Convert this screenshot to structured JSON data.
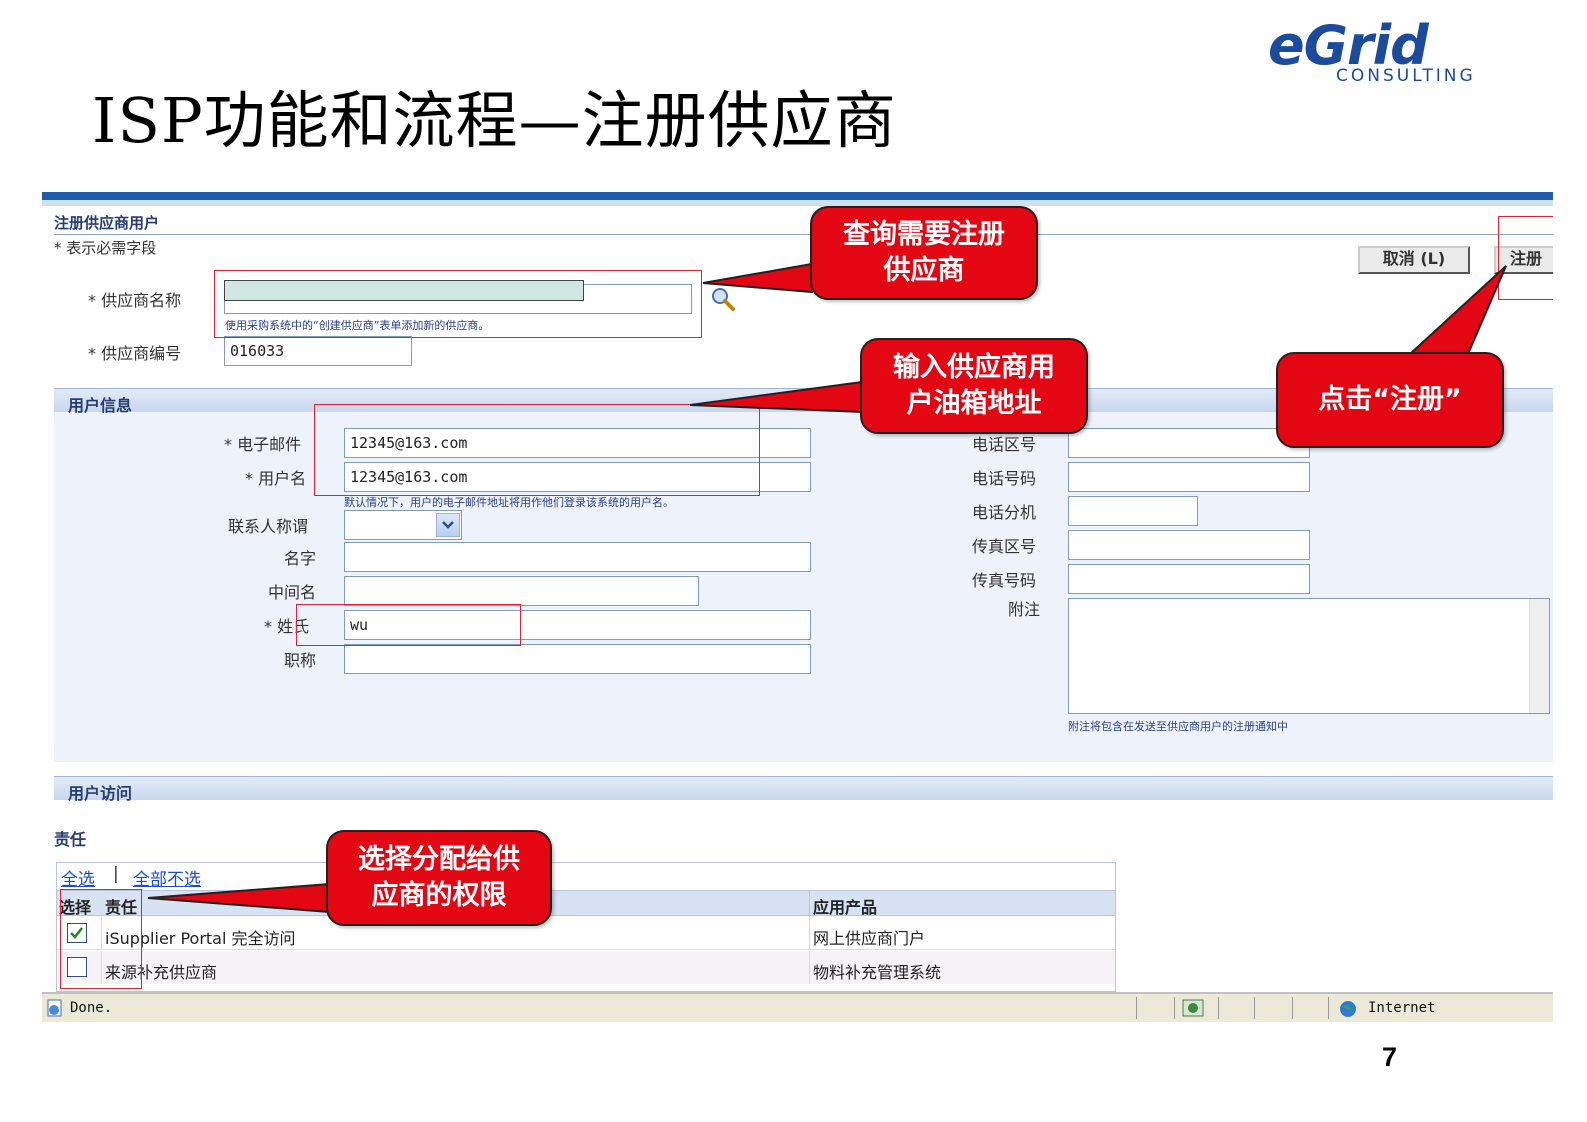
{
  "slide": {
    "title": "ISP功能和流程—注册供应商",
    "logo_main": "eGrid",
    "logo_sub": "CONSULTING",
    "page_number": "7"
  },
  "form": {
    "header": "注册供应商用户",
    "required_note": "* 表示必需字段",
    "cancel_button": "取消 (L)",
    "register_button": "注册",
    "supplier_name_label": "* 供应商名称",
    "supplier_name_hint": "使用采购系统中的“创建供应商”表单添加新的供应商。",
    "supplier_number_label": "* 供应商编号",
    "supplier_number_value": "016033"
  },
  "user_info": {
    "header": "用户信息",
    "email_label": "* 电子邮件",
    "email_value": "12345@163.com",
    "username_label": "* 用户名",
    "username_value": "12345@163.com",
    "username_hint": "默认情况下，用户的电子邮件地址将用作他们登录该系统的用户名。",
    "salutation_label": "联系人称谓",
    "first_name_label": "名字",
    "middle_name_label": "中间名",
    "last_name_label": "* 姓氏",
    "last_name_value": "wu",
    "job_title_label": "职称",
    "phone_area_label": "电话区号",
    "phone_number_label": "电话号码",
    "phone_ext_label": "电话分机",
    "fax_area_label": "传真区号",
    "fax_number_label": "传真号码",
    "notes_label": "附注",
    "notes_hint": "附注将包含在发送至供应商用户的注册通知中"
  },
  "user_access": {
    "header": "用户访问",
    "responsibilities_label": "责任",
    "select_all": "全选",
    "separator": "|",
    "select_none": "全部不选",
    "columns": [
      "选择",
      "责任",
      "应用产品"
    ],
    "rows": [
      {
        "checked": true,
        "responsibility": "iSupplier Portal 完全访问",
        "application": "网上供应商门户"
      },
      {
        "checked": false,
        "responsibility": "来源补充供应商",
        "application": "物料补充管理系统"
      }
    ]
  },
  "callouts": {
    "query_supplier": [
      "查询需要注册",
      "供应商"
    ],
    "enter_email": [
      "输入供应商用",
      "户油箱地址"
    ],
    "click_register": [
      "点击“注册”"
    ],
    "select_permissions": [
      "选择分配给供",
      "应商的权限"
    ]
  },
  "statusbar": {
    "done": "Done.",
    "zone": "Internet"
  },
  "colors": {
    "accent_blue": "#205cab",
    "callout_red": "#e30613",
    "highlight_red": "#e0232c",
    "supplier_name_fill": "#cfe8e4"
  }
}
